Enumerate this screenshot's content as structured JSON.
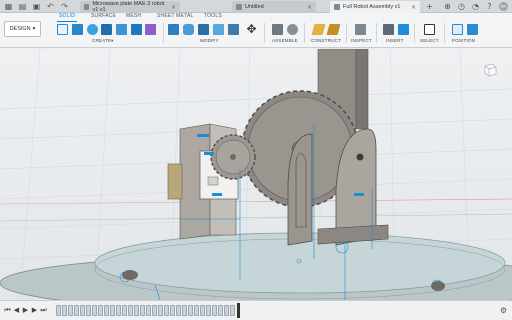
{
  "tabs": [
    {
      "label": "Microwave plate MAE 3 robot v1 v1",
      "active": false
    },
    {
      "label": "Untitled",
      "active": false
    },
    {
      "label": "Full Robot Assembly v1",
      "active": true
    }
  ],
  "workspace_button": "DESIGN",
  "workspace_tabs": [
    "SOLID",
    "SURFACE",
    "MESH",
    "SHEET METAL",
    "TOOLS"
  ],
  "active_workspace_tab": "SOLID",
  "groups": [
    "CREATE",
    "MODIFY",
    "ASSEMBLE",
    "CONSTRUCT",
    "INSPECT",
    "INSERT",
    "SELECT",
    "POSITION"
  ],
  "user_initials": "PA",
  "colors": {
    "accent": "#0a7fd8",
    "sketch_blue": "#1a8fd6",
    "part_grey": "#8f8b86",
    "plate_green": "#9ec2c6"
  },
  "icons": {
    "app_grid": "app-grid-icon",
    "save": "save-icon",
    "undo": "undo-icon",
    "redo": "redo-icon",
    "viewcube": "viewcube-icon"
  }
}
